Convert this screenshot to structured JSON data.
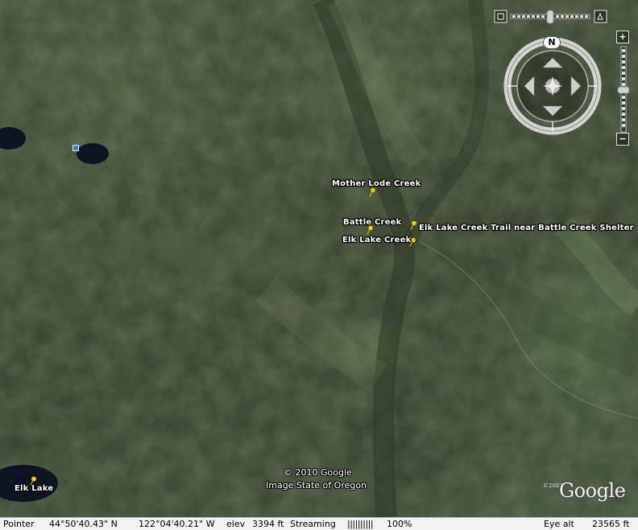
{
  "map": {
    "placemarks": [
      {
        "label": "Mother Lode Creek"
      },
      {
        "label": "Battle Creek"
      },
      {
        "label": "Elk Lake Creek Trail near Battle Creek Shelter"
      },
      {
        "label": "Elk Lake Creek"
      },
      {
        "label": "Elk Lake"
      }
    ],
    "copyright_line1": "© 2010 Google",
    "copyright_line2": "Image State of Oregon",
    "logo_year": "©2007",
    "logo_text": "Google",
    "pin_color": "#f5d20a",
    "marker_color": "#4a79d8"
  },
  "controls": {
    "north_label": "N",
    "zoom_in_label": "+",
    "zoom_out_label": "−"
  },
  "status": {
    "pointer_label": "Pointer",
    "latitude": "44°50'40.43\" N",
    "longitude": "122°04'40.21\" W",
    "elev_label": "elev",
    "elevation": "3394 ft",
    "streaming_label": "Streaming",
    "streaming_bar": "||||||||||",
    "streaming_percent": "100%",
    "eye_alt_label": "Eye alt",
    "eye_alt": "23565 ft"
  }
}
